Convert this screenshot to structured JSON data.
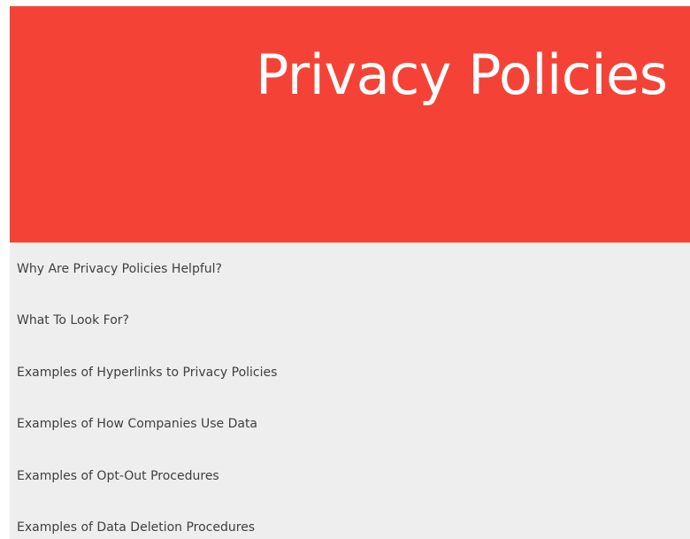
{
  "hero": {
    "title": "Privacy Policies",
    "background_color": "#f44336",
    "text_color": "#ffffff"
  },
  "nav": {
    "background_color": "#eeeeee",
    "items": [
      {
        "label": "Why Are Privacy Policies Helpful?"
      },
      {
        "label": "What To Look For?"
      },
      {
        "label": "Examples of Hyperlinks to Privacy Policies"
      },
      {
        "label": "Examples of How Companies Use Data"
      },
      {
        "label": "Examples of Opt-Out Procedures"
      },
      {
        "label": "Examples of Data Deletion Procedures"
      }
    ]
  }
}
